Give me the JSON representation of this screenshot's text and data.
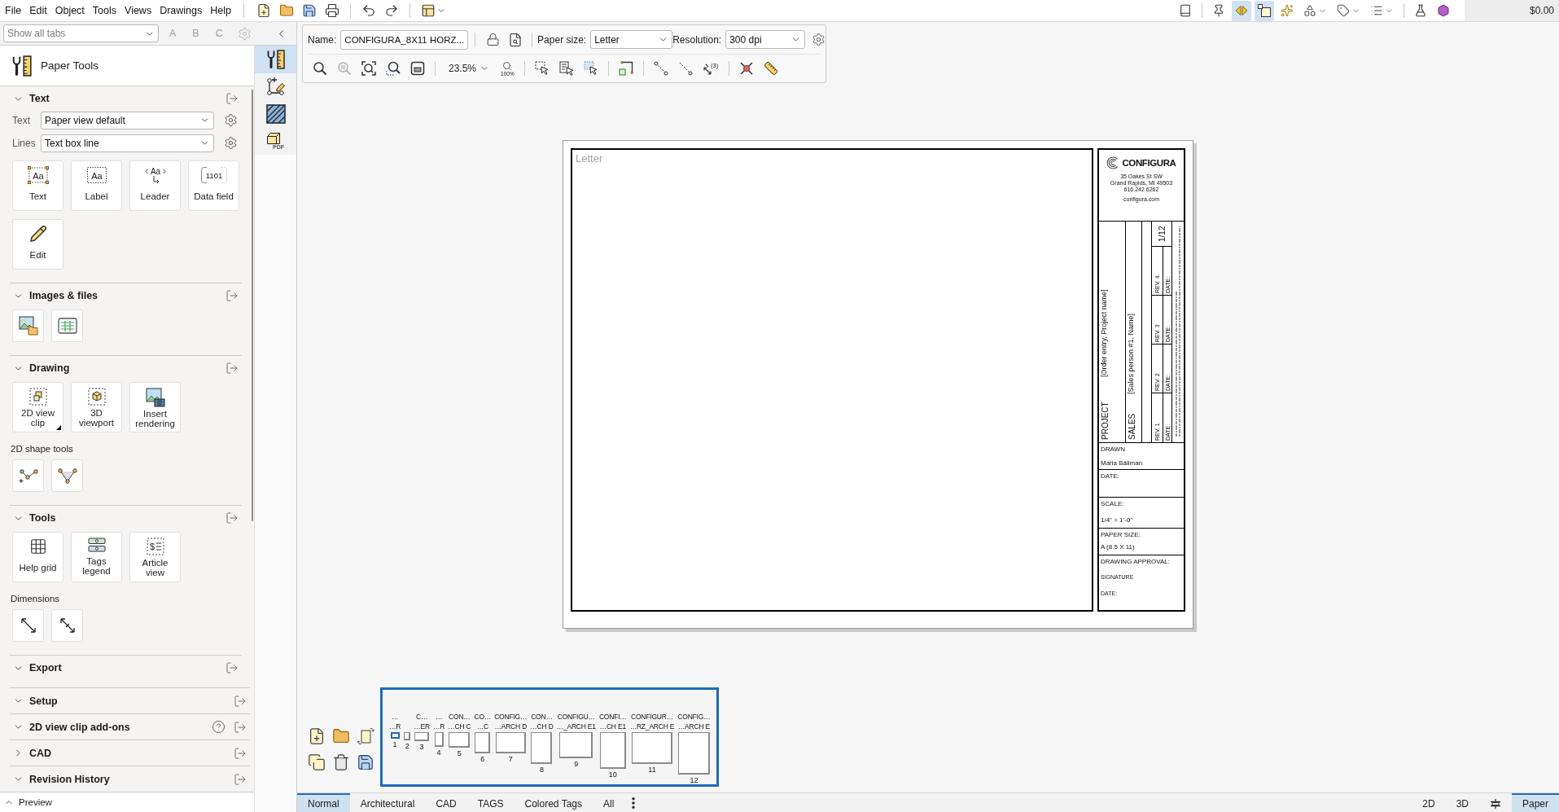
{
  "menu_bar": {
    "items": [
      "File",
      "Edit",
      "Object",
      "Tools",
      "Views",
      "Drawings",
      "Help"
    ]
  },
  "mode_toolbar": {
    "tools": [
      {
        "kind": "book",
        "selected": false
      },
      {
        "kind": "pin",
        "selected": false
      },
      {
        "kind": "mirror",
        "selected": true
      },
      {
        "kind": "frame",
        "selected": true
      },
      {
        "kind": "wand",
        "selected": false
      },
      {
        "kind": "shapes",
        "selected": false
      },
      {
        "kind": "tag",
        "selected": false
      },
      {
        "kind": "list",
        "selected": false
      },
      {
        "kind": "flask",
        "selected": false
      },
      {
        "kind": "hexagon",
        "selected": false
      }
    ],
    "price": "$0.00"
  },
  "panel_header": {
    "tab_filter": {
      "placeholder": "Show all tabs"
    },
    "letters": [
      {
        "label": "A",
        "disabled": true
      },
      {
        "label": "B",
        "disabled": true
      },
      {
        "label": "C",
        "disabled": true
      }
    ]
  },
  "side_strip": [
    {
      "kind": "paper-tools",
      "selected": true
    },
    {
      "kind": "draw-points",
      "selected": false
    },
    {
      "kind": "hatch",
      "selected": false
    },
    {
      "kind": "pdf-export",
      "selected": false,
      "icon_text": "PDF"
    }
  ],
  "panel": {
    "title": "Paper Tools",
    "sections": [
      {
        "title": "Text",
        "expanded": true,
        "fields": [
          {
            "label": "Text",
            "value": "Paper view default"
          },
          {
            "label": "Lines",
            "value": "Text box line"
          }
        ],
        "groups": [
          {
            "tools": [
              {
                "kind": "text",
                "label": "Text",
                "icon_text": "Aa"
              },
              {
                "kind": "label",
                "label": "Label",
                "icon_text": "Aa"
              },
              {
                "kind": "leader",
                "label": "Leader",
                "icon_text": "Aa"
              },
              {
                "kind": "data-field",
                "label": "Data field",
                "icon_text": "1101"
              },
              {
                "kind": "edit",
                "label": "Edit"
              }
            ]
          }
        ]
      },
      {
        "title": "Images & files",
        "expanded": true,
        "groups": [
          {
            "tools": [
              {
                "kind": "image"
              },
              {
                "kind": "table"
              }
            ]
          }
        ]
      },
      {
        "title": "Drawing",
        "expanded": true,
        "groups": [
          {
            "tools": [
              {
                "kind": "view-clip",
                "label": "2D view clip",
                "has_menu": true
              },
              {
                "kind": "viewport",
                "label": "3D viewport"
              },
              {
                "kind": "rendering",
                "label": "Insert rendering"
              }
            ]
          },
          {
            "title": "2D shape tools",
            "tools": [
              {
                "kind": "polyline-add"
              },
              {
                "kind": "polyline"
              }
            ]
          }
        ]
      },
      {
        "title": "Tools",
        "expanded": true,
        "groups": [
          {
            "tools": [
              {
                "kind": "grid",
                "label": "Help grid"
              },
              {
                "kind": "tags",
                "label": "Tags legend"
              },
              {
                "kind": "article",
                "label": "Article view",
                "icon_text": "$"
              }
            ]
          },
          {
            "title": "Dimensions",
            "tools": [
              {
                "kind": "dimension"
              },
              {
                "kind": "dimension-ticks"
              }
            ]
          }
        ]
      },
      {
        "title": "Export",
        "expanded": true
      }
    ],
    "docked_sections": [
      {
        "title": "Setup",
        "expanded": true
      },
      {
        "title": "2D view clip add-ons",
        "expanded": true,
        "help": true
      },
      {
        "title": "CAD",
        "expanded": false
      },
      {
        "title": "Revision History",
        "expanded": true
      }
    ],
    "preview": {
      "title": "Preview",
      "expanded": false
    }
  },
  "paper_toolbar": {
    "name_label": "Name:",
    "name_value": "CONFIGURA_8X11 HORZ...",
    "paper_size_label": "Paper size:",
    "paper_size": "Letter",
    "resolution_label": "Resolution:",
    "resolution": "300 dpi",
    "zoom": "23.5%",
    "zoom_100": "100%",
    "measure_count": "(3)",
    "zoom_tools": [
      {
        "kind": "zoom",
        "disabled": false
      },
      {
        "kind": "zoom-previous",
        "disabled": true
      },
      {
        "kind": "zoom-extents",
        "disabled": false
      },
      {
        "kind": "zoom-selection",
        "disabled": false
      },
      {
        "kind": "zoom-window",
        "disabled": false
      }
    ]
  },
  "paper": {
    "sheet_label": "Letter",
    "title_block": {
      "company": "CONFIGURA",
      "address": [
        "35 Oakes St SW",
        "Grand Rapids, MI 49503",
        "616.242.6262"
      ],
      "website": "configura.com",
      "project_label": "PROJECT",
      "project": "[Order entry, Project name]",
      "sales_label": "SALES",
      "sales": "[Sales person #1, Name]",
      "sheet": "1/12",
      "revisions": [
        {
          "label": "REV. 1",
          "date_label": "DATE:"
        },
        {
          "label": "REV. 2",
          "date_label": "DATE:"
        },
        {
          "label": "REV. 3",
          "date_label": "DATE:"
        },
        {
          "label": "REV. 4",
          "date_label": "DATE:"
        }
      ],
      "fields": [
        {
          "label": "DRAWN",
          "value": "Maria Bällman"
        },
        {
          "label": "DATE:"
        },
        {
          "label": "SCALE:",
          "value": "1/4\" = 1'-0\""
        },
        {
          "label": "PAPER SIZE:",
          "value": "A  (8.5 X 11)"
        }
      ],
      "approval": {
        "label": "DRAWING APPROVAL:",
        "lines": [
          "SIGNATURE",
          "DATE:"
        ]
      }
    }
  },
  "thumbnails": [
    {
      "top": "…",
      "bottom": "…R",
      "number": "1",
      "selected": true
    },
    {
      "number": "2",
      "selected": false
    },
    {
      "top": "C…",
      "bottom": "…ER",
      "number": "3",
      "selected": false
    },
    {
      "top": "…",
      "bottom": "…R",
      "number": "4",
      "selected": false
    },
    {
      "top": "CON…",
      "bottom": "…CH C",
      "number": "5",
      "selected": false
    },
    {
      "top": "CO…",
      "bottom": "…C",
      "number": "6",
      "selected": false
    },
    {
      "top": "CONFIG…",
      "bottom": "…ARCH D",
      "number": "7",
      "selected": false
    },
    {
      "top": "CON…",
      "bottom": "…CH D",
      "number": "8",
      "selected": false
    },
    {
      "top": "CONFIGU…",
      "bottom": "…_ARCH E1",
      "number": "9",
      "selected": false
    },
    {
      "top": "CONFI…",
      "bottom": "…CH E1",
      "number": "10",
      "selected": false
    },
    {
      "top": "CONFIGUR…",
      "bottom": "…RZ_ARCH E",
      "number": "11",
      "selected": false
    },
    {
      "top": "CONFIG…",
      "bottom": "…ARCH E",
      "number": "12",
      "selected": false
    }
  ],
  "sheet_tabs": [
    {
      "label": "Normal",
      "selected": true
    },
    {
      "label": "Architectural",
      "selected": false
    },
    {
      "label": "CAD",
      "selected": false
    },
    {
      "label": "TAGS",
      "selected": false
    },
    {
      "label": "Colored Tags",
      "selected": false
    },
    {
      "label": "All",
      "selected": false
    }
  ],
  "view_tabs": [
    {
      "kind": "text",
      "label": "2D",
      "selected": false
    },
    {
      "kind": "text",
      "label": "3D",
      "selected": false
    },
    {
      "kind": "elevation",
      "selected": false
    },
    {
      "kind": "text",
      "label": "Paper",
      "selected": true
    }
  ]
}
